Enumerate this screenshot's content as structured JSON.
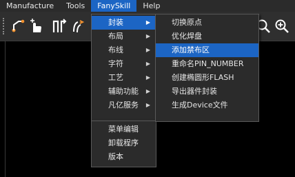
{
  "menubar": {
    "items": [
      {
        "label": "Manufacture"
      },
      {
        "label": "Tools"
      },
      {
        "label": "FanySkill"
      },
      {
        "label": "Help"
      }
    ]
  },
  "toolbar": {
    "icons": [
      "route-icon",
      "pointer-hand-icon",
      "bus-icon",
      "diff-pair-icon",
      "zoom-in-icon"
    ]
  },
  "main_menu": {
    "items": [
      {
        "label": "封装"
      },
      {
        "label": "布局"
      },
      {
        "label": "布线"
      },
      {
        "label": "字符"
      },
      {
        "label": "工艺"
      },
      {
        "label": "辅助功能"
      },
      {
        "label": "凡亿服务"
      }
    ]
  },
  "extra_menu": {
    "items": [
      {
        "label": "菜单编辑"
      },
      {
        "label": "卸载程序"
      },
      {
        "label": "版本"
      }
    ]
  },
  "sub_menu": {
    "items": [
      {
        "label": "切换原点"
      },
      {
        "label": "优化焊盘"
      },
      {
        "label": "添加禁布区"
      },
      {
        "label": "重命名PIN_NUMBER"
      },
      {
        "label": "创建椭圆形FLASH"
      },
      {
        "label": "导出器件封装"
      },
      {
        "label": "生成Device文件"
      }
    ]
  },
  "colors": {
    "highlight": "#1c65c4",
    "menu_bg": "#2b2b2b",
    "canvas_bg": "#000000"
  }
}
